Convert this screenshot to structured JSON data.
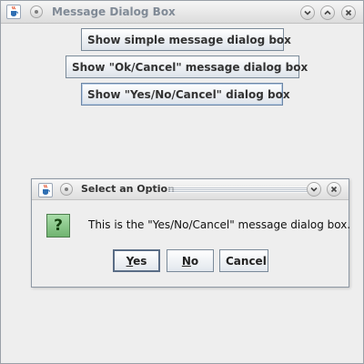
{
  "window": {
    "title": "Message Dialog Box",
    "icons": [
      "java-cup-icon",
      "window-menu-icon",
      "minimize-icon",
      "maximize-icon",
      "close-icon"
    ]
  },
  "main": {
    "buttons": [
      {
        "label": "Show simple message dialog box"
      },
      {
        "label": "Show \"Ok/Cancel\" message dialog box"
      },
      {
        "label": "Show \"Yes/No/Cancel\" dialog box"
      }
    ]
  },
  "dialog": {
    "title": "Select an Option",
    "icon": "question-icon",
    "icon_glyph": "?",
    "message": "This is the \"Yes/No/Cancel\" message dialog box.",
    "buttons": {
      "yes_mnemonic": "Y",
      "yes_rest": "es",
      "no_mnemonic": "N",
      "no_rest": "o",
      "cancel": "Cancel"
    }
  },
  "colors": {
    "background": "#eeeeee",
    "button_border": "#7a8a99",
    "question_icon": "#7fbf7f"
  }
}
